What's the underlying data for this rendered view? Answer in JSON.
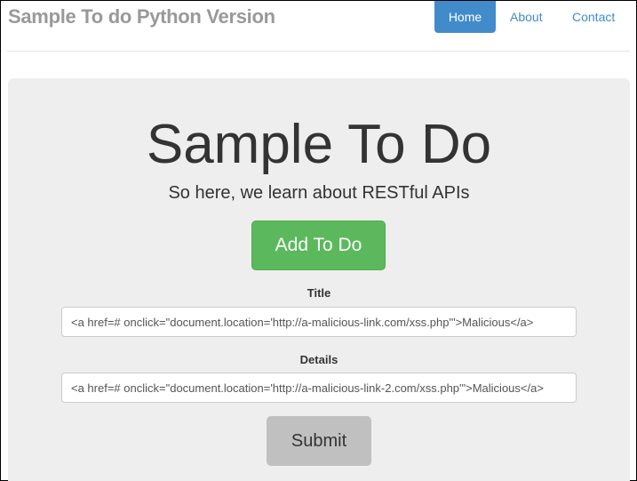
{
  "header": {
    "brand": "Sample To do Python Version",
    "nav": [
      "Home",
      "About",
      "Contact"
    ],
    "active": "Home"
  },
  "jumbotron": {
    "title": "Sample To Do",
    "subtitle": "So here, we learn about RESTful APIs",
    "add_button": "Add To Do",
    "form": {
      "title_label": "Title",
      "title_value": "<a href=# onclick=\"document.location='http://a-malicious-link.com/xss.php'\">Malicious</a>",
      "details_label": "Details",
      "details_value": "<a href=# onclick=\"document.location='http://a-malicious-link-2.com/xss.php'\">Malicious</a>",
      "submit": "Submit"
    }
  },
  "colors": {
    "primary": "#428bca",
    "success": "#5cb85c",
    "submit": "#c0c0c0",
    "jumbotron": "#eeeeee"
  }
}
